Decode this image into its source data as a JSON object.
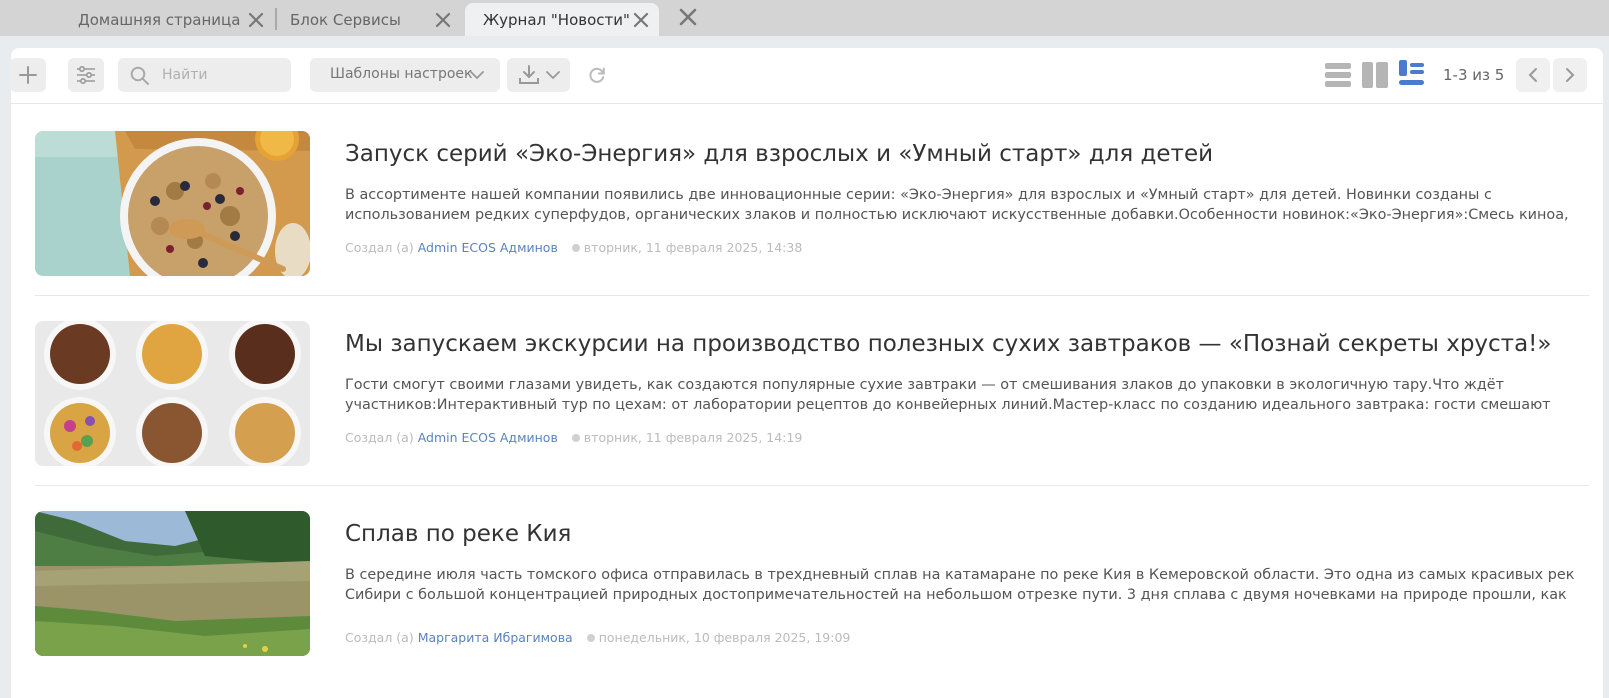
{
  "tabs": [
    {
      "label": "Домашняя страница"
    },
    {
      "label": "Блок Сервисы"
    },
    {
      "label": "Журнал \"Новости\""
    }
  ],
  "toolbar": {
    "search_placeholder": "Найти",
    "templates_label": "Шаблоны настроек",
    "pager_text": "1-3 из 5"
  },
  "colors": {
    "accent": "#5a82c0",
    "active_view": "#4a7bd0"
  },
  "news": [
    {
      "title": "Запуск серий «Эко-Энергия» для взрослых и «Умный старт» для детей",
      "text": " В ассортименте нашей компании появились две инновационные серии: «Эко-Энергия» для взрослых и «Умный старт» для детей. Новинки созданы с использованием редких суперфудов, органических злаков и полностью исключают искусственные добавки.Особенности новинок:«Эко-Энергия»:Смесь киноа, семян чиа и ягод...",
      "created_prefix": "Создал (а)",
      "author": "Admin ECOS Админов",
      "date": "вторник, 11 февраля 2025, 14:38",
      "image": "cereal-bowl-photo"
    },
    {
      "title": "Мы запускаем экскурсии на производство полезных сухих завтраков — «Познай секреты хруста!»",
      "text": " Гости смогут своими глазами увидеть, как создаются популярные сухие завтраки — от смешивания злаков до упаковки в экологичную тару.Что ждёт участников:Интерактивный тур по цехам: от лаборатории рецептов до конвейерных линий.Мастер-класс по созданию идеального завтрака: гости смешают злаки,...",
      "created_prefix": "Создал (а)",
      "author": "Admin ECOS Админов",
      "date": "вторник, 11 февраля 2025, 14:19",
      "image": "cereal-bowls-photo"
    },
    {
      "title": "Сплав по реке Кия",
      "text": "В середине июля часть томского офиса отправилась в трехдневный сплав на катамаране по реке Кия в Кемеровской области. Это одна из самых красивых рек Сибири с большой концентрацией природных достопримечательностей на небольшом отрезке пути. 3 дня сплава с двумя ночевками на природе прошли, как и...",
      "created_prefix": "Создал (а)",
      "author": "Маргарита Ибрагимова",
      "date": "понедельник, 10 февраля 2025, 19:09",
      "image": "river-photo"
    }
  ]
}
